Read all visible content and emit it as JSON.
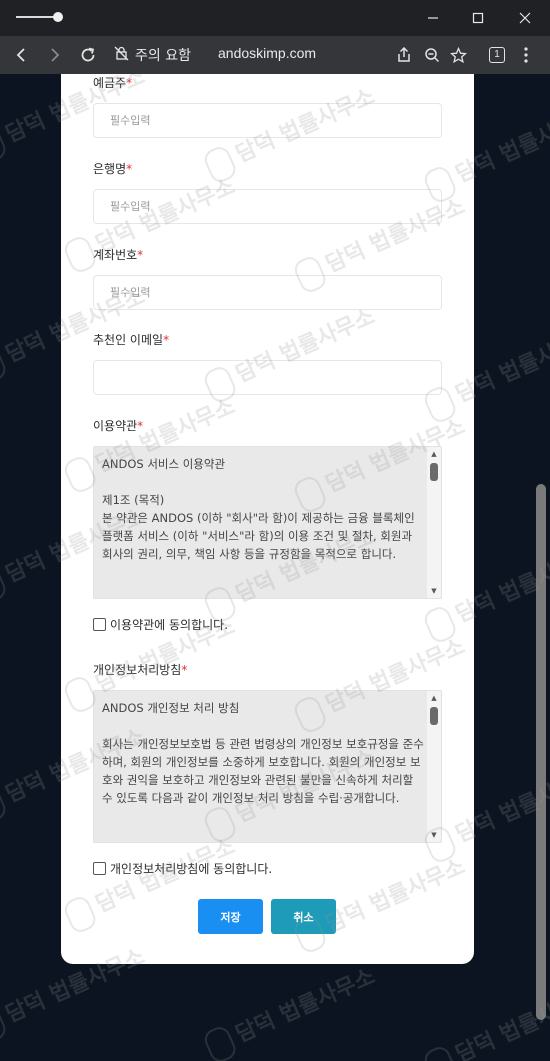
{
  "browser": {
    "security_label": "주의 요함",
    "url": "andoskimp.com",
    "tab_count": "1",
    "icons": [
      "back-icon",
      "forward-icon",
      "reload-icon",
      "not-secure-icon",
      "share-icon",
      "zoom-out-icon",
      "bookmark-star-icon",
      "tab-count-icon",
      "more-menu-icon",
      "minimize-icon",
      "maximize-icon",
      "close-icon"
    ]
  },
  "form": {
    "depositor": {
      "label": "예금주",
      "placeholder": "필수입력"
    },
    "bank_name": {
      "label": "은행명",
      "placeholder": "필수입력"
    },
    "account_number": {
      "label": "계좌번호",
      "placeholder": "필수입력"
    },
    "referrer_email": {
      "label": "추천인 이메일",
      "placeholder": ""
    },
    "required_mark": "*",
    "terms": {
      "label": "이용약관",
      "text": "ANDOS 서비스 이용약관\n\n제1조 (목적)\n본 약관은 ANDOS (이하 \"회사\"라 함)이 제공하는 금융 블록체인 플랫폼 서비스 (이하 \"서비스\"라 함)의 이용 조건 및 절차, 회원과 회사의 권리, 의무, 책임 사항 등을 규정함을 목적으로 합니다.",
      "agree_label": "이용약관에 동의합니다."
    },
    "privacy": {
      "label": "개인정보처리방침",
      "text": "ANDOS 개인정보 처리 방침\n\n회사는 개인정보보호법 등 관련 법령상의 개인정보 보호규정을 준수하며, 회원의 개인정보를 소중하게 보호합니다. 회원의 개인정보 보호와 권익을 보호하고 개인정보와 관련된 불만을 신속하게 처리할 수 있도록 다음과 같이 개인정보 처리 방침을 수립·공개합니다.",
      "agree_label": "개인정보처리방침에 동의합니다."
    },
    "save_label": "저장",
    "cancel_label": "취소"
  },
  "watermark_text": "담덕 법률사무소",
  "colors": {
    "save_button": "#1a8ff2",
    "cancel_button": "#1d9bb8",
    "required": "#e0303a",
    "page_background": "#0b1420"
  }
}
